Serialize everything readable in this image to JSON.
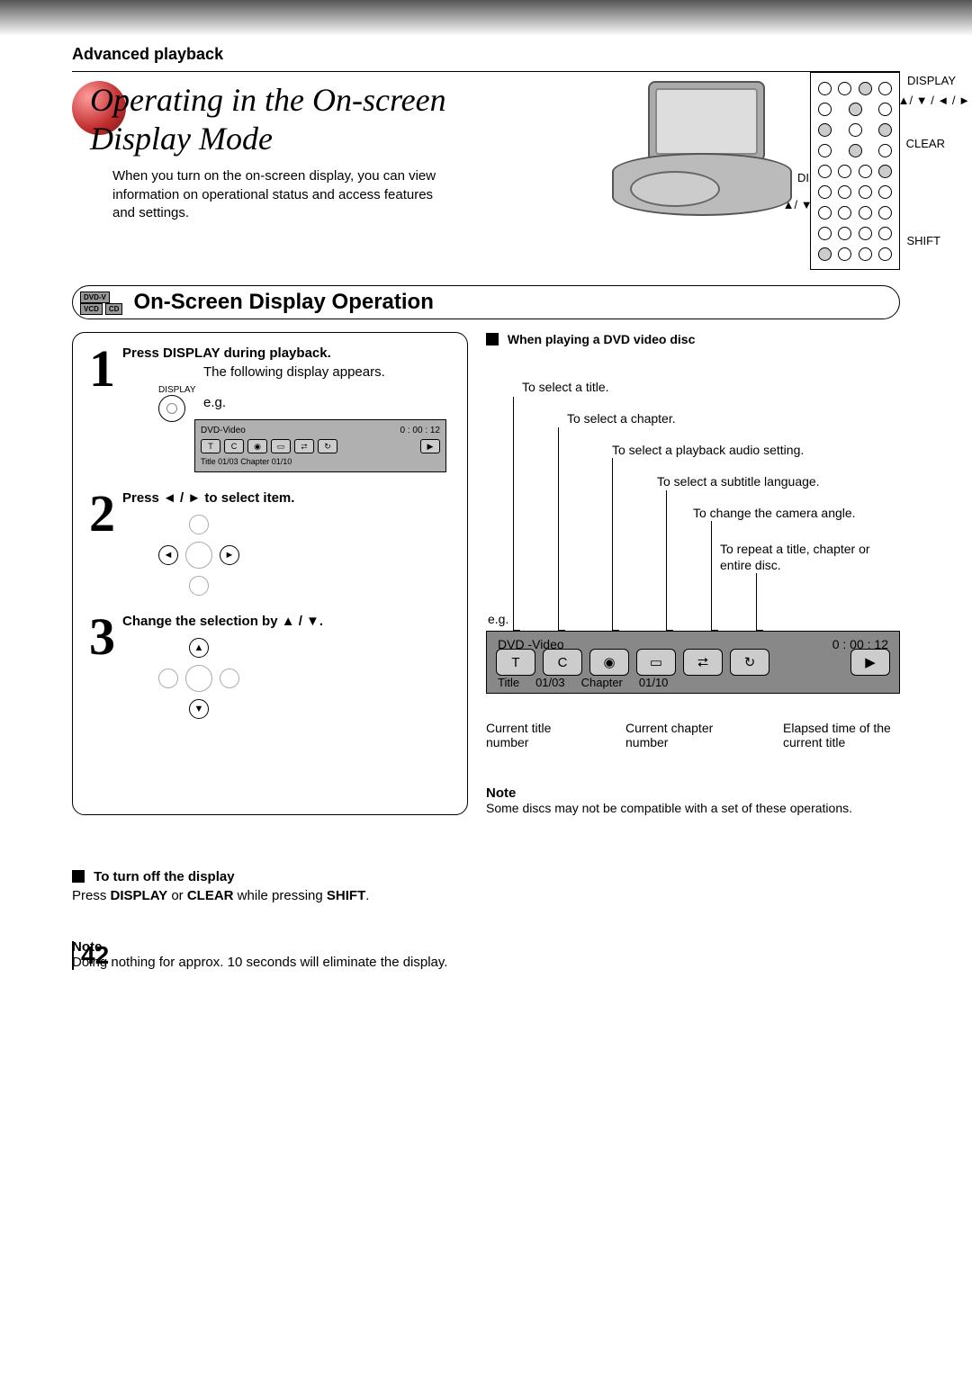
{
  "header": {
    "crumb": "Advanced playback"
  },
  "title": {
    "line1": "Operating in the On-screen",
    "line2": "Display Mode",
    "intro": "When you turn on the on-screen display, you can view information on operational status and access features and settings."
  },
  "player_labels": {
    "display": "DISPLAY",
    "arrows": "▲/ ▼ / ◄ / ►"
  },
  "remote_labels": {
    "display": "DISPLAY",
    "arrows": "▲/ ▼ / ◄ / ►",
    "clear": "CLEAR",
    "shift": "SHIFT"
  },
  "section": {
    "badges": {
      "dvd": "DVD-V",
      "vcd": "VCD",
      "cd": "CD"
    },
    "title": "On-Screen Display Operation"
  },
  "steps": {
    "s1": {
      "title": "Press DISPLAY during playback.",
      "body": "The following display appears.",
      "eg": "e.g.",
      "btn_label": "DISPLAY"
    },
    "s2": {
      "title": "Press ◄ / ► to select item."
    },
    "s3": {
      "title": "Change the selection by ▲ / ▼."
    }
  },
  "osd_example": {
    "top_left": "DVD-Video",
    "top_right": "0 : 00 : 12",
    "icons": {
      "t": "T",
      "c": "C"
    },
    "bottom": "Title    01/03   Chapter   01/10"
  },
  "right": {
    "heading": "When playing a DVD video disc",
    "select_title": "To select a title.",
    "select_chapter": "To select a chapter.",
    "select_audio": "To select a playback audio setting.",
    "select_subtitle": "To select a subtitle language.",
    "change_angle": "To change the camera angle.",
    "repeat": "To repeat a title, chapter or entire disc.",
    "eg": "e.g.",
    "big_osd": {
      "top_left": "DVD -Video",
      "top_right": "0 : 00 : 12",
      "t": "T",
      "c": "C",
      "bottom_title": "Title",
      "bottom_t": "01/03",
      "bottom_chapter": "Chapter",
      "bottom_c": "01/10"
    },
    "bottom_callouts": {
      "cur_title": "Current title number",
      "cur_chapter": "Current chapter number",
      "elapsed": "Elapsed time of the current title"
    },
    "note_head": "Note",
    "note_body": "Some discs may not be compatible with a set of these operations."
  },
  "turnoff": {
    "head": "To turn off the display",
    "body_a": "Press ",
    "body_b": "DISPLAY",
    "body_c": " or ",
    "body_d": "CLEAR",
    "body_e": " while pressing ",
    "body_f": "SHIFT",
    "body_g": ".",
    "note_head": "Note",
    "note_body": "Doing nothing for approx. 10 seconds will eliminate the display."
  },
  "page_number": "42"
}
